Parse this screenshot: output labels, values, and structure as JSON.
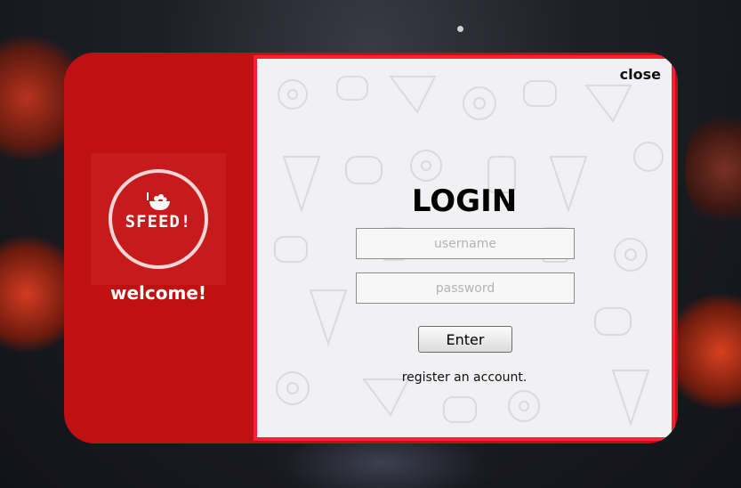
{
  "welcome": {
    "logo_text": "SFEED!",
    "greeting": "welcome!"
  },
  "login": {
    "close_label": "close",
    "title": "LOGIN",
    "username_placeholder": "username",
    "password_placeholder": "password",
    "enter_label": "Enter",
    "register_label": "register an account."
  },
  "colors": {
    "panel_red": "#c01112",
    "frame_border": "#ff1c3a",
    "form_background": "#f1f1f3"
  },
  "icons": [
    "bowl-icon",
    "food-pattern"
  ]
}
